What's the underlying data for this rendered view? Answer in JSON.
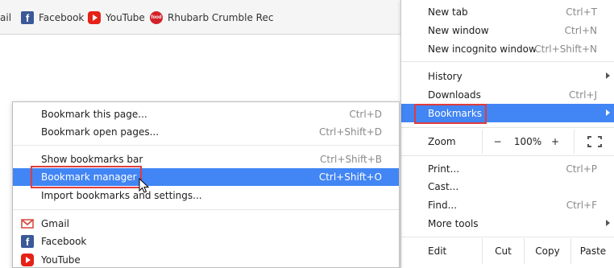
{
  "bookmarks_bar": {
    "items": [
      {
        "label": "ail",
        "icon": "none"
      },
      {
        "label": "Facebook",
        "icon": "facebook-icon"
      },
      {
        "label": "YouTube",
        "icon": "youtube-icon"
      },
      {
        "label": "Rhubarb Crumble Rec",
        "icon": "food-icon"
      }
    ]
  },
  "main_menu": {
    "new_tab": {
      "label": "New tab",
      "shortcut": "Ctrl+T"
    },
    "new_window": {
      "label": "New window",
      "shortcut": "Ctrl+N"
    },
    "new_incognito": {
      "label": "New incognito window",
      "shortcut": "Ctrl+Shift+N"
    },
    "history": {
      "label": "History"
    },
    "downloads": {
      "label": "Downloads",
      "shortcut": "Ctrl+J"
    },
    "bookmarks": {
      "label": "Bookmarks"
    },
    "zoom": {
      "label": "Zoom",
      "minus": "−",
      "value": "100%",
      "plus": "+"
    },
    "print": {
      "label": "Print...",
      "shortcut": "Ctrl+P"
    },
    "cast": {
      "label": "Cast..."
    },
    "find": {
      "label": "Find...",
      "shortcut": "Ctrl+F"
    },
    "more_tools": {
      "label": "More tools"
    },
    "edit": {
      "label": "Edit",
      "cut": "Cut",
      "copy": "Copy",
      "paste": "Paste"
    }
  },
  "bookmarks_submenu": {
    "bookmark_page": {
      "label": "Bookmark this page...",
      "shortcut": "Ctrl+D"
    },
    "bookmark_open_pages": {
      "label": "Bookmark open pages...",
      "shortcut": "Ctrl+Shift+D"
    },
    "show_bar": {
      "label": "Show bookmarks bar",
      "shortcut": "Ctrl+Shift+B"
    },
    "manager": {
      "label": "Bookmark manager",
      "shortcut": "Ctrl+Shift+O"
    },
    "import": {
      "label": "Import bookmarks and settings..."
    },
    "items": [
      {
        "label": "Gmail",
        "icon": "gmail-icon"
      },
      {
        "label": "Facebook",
        "icon": "facebook-icon"
      },
      {
        "label": "YouTube",
        "icon": "youtube-icon"
      }
    ]
  },
  "colors": {
    "highlight": "#4285f4",
    "annotation_red": "#e03c3c"
  }
}
